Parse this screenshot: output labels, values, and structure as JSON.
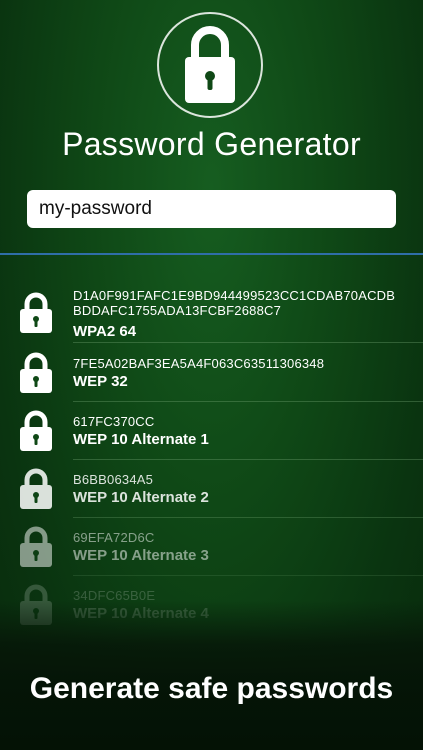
{
  "header": {
    "title": "Password Generator",
    "logo_icon": "padlock-icon"
  },
  "input": {
    "value": "my-password",
    "placeholder": ""
  },
  "results": [
    {
      "hash": "D1A0F991FAFC1E9BD944499523CC1CDAB70ACDB BDDAFC1755ADA13FCBF2688C7",
      "type": "WPA2 64"
    },
    {
      "hash": "7FE5A02BAF3EA5A4F063C63511306348",
      "type": "WEP 32"
    },
    {
      "hash": "617FC370CC",
      "type": "WEP 10 Alternate 1"
    },
    {
      "hash": "B6BB0634A5",
      "type": "WEP 10 Alternate 2"
    },
    {
      "hash": "69EFA72D6C",
      "type": "WEP 10 Alternate 3"
    },
    {
      "hash": "34DFC65B0E",
      "type": "WEP 10 Alternate 4"
    }
  ],
  "footer": {
    "tagline": "Generate safe passwords"
  },
  "colors": {
    "background": "#0f4816",
    "divider": "#2f6ea8",
    "text": "#ffffff"
  }
}
